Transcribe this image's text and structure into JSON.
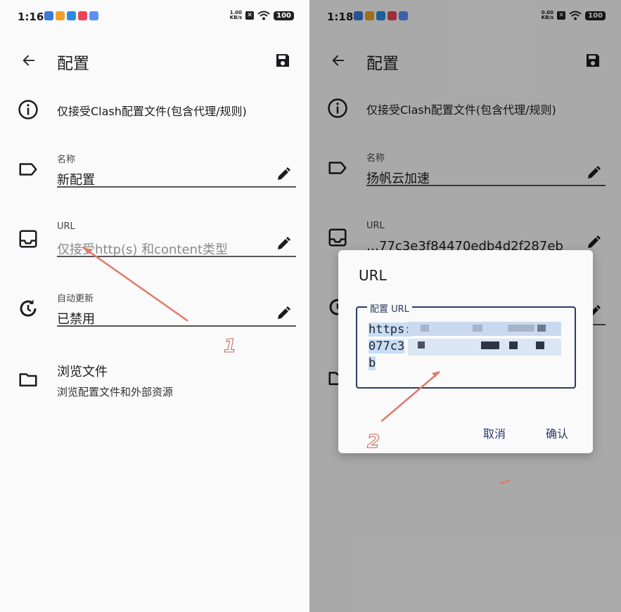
{
  "left": {
    "status": {
      "time": "1:16",
      "net_value": "1.00",
      "net_unit": "KB/s",
      "battery": "100"
    },
    "header": {
      "title": "配置"
    },
    "info": "仅接受Clash配置文件(包含代理/规则)",
    "name_field": {
      "label": "名称",
      "value": "新配置"
    },
    "url_field": {
      "label": "URL",
      "placeholder": "仅接受http(s) 和content类型"
    },
    "auto_update": {
      "label": "自动更新",
      "value": "已禁用"
    },
    "browse": {
      "title": "浏览文件",
      "subtitle": "浏览配置文件和外部资源"
    },
    "annotation": "1"
  },
  "right": {
    "status": {
      "time": "1:18",
      "net_value": "0.00",
      "net_unit": "KB/s",
      "battery": "100"
    },
    "header": {
      "title": "配置"
    },
    "info": "仅接受Clash配置文件(包含代理/规则)",
    "name_field": {
      "label": "名称",
      "value": "扬帆云加速"
    },
    "url_field": {
      "label": "URL",
      "value": "…77c3e3f84470edb4d2f287eb"
    },
    "dialog": {
      "title": "URL",
      "field_label": "配置 URL",
      "line1": "https:",
      "line2": "077c3",
      "line3": "b",
      "cancel": "取消",
      "confirm": "确认"
    },
    "annotation": "2"
  },
  "colors": {
    "accent": "#2b3a67",
    "arrow": "#e07a6a",
    "selection": "#c7ddf7"
  }
}
